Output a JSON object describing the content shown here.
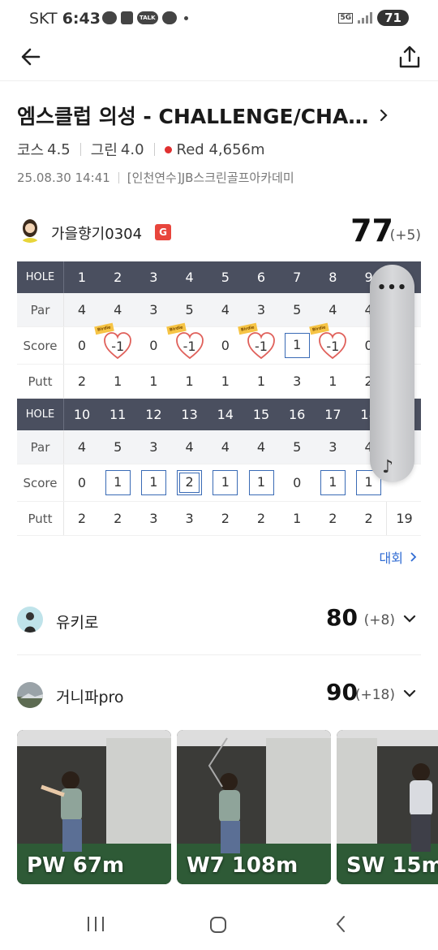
{
  "status": {
    "carrier": "SKT",
    "time": "6:43",
    "talk": "TALK",
    "network": "5G",
    "battery": "71"
  },
  "course": {
    "title": "엠스클럽 의성 - CHALLENGE/CHA…",
    "course_label": "코스",
    "course_value": "4.5",
    "green_label": "그린",
    "green_value": "4.0",
    "tee": "Red 4,656m",
    "datetime": "25.08.30 14:41",
    "venue": "[인천연수]JB스크린골프아카데미"
  },
  "player1": {
    "name": "가을향기0304",
    "badge": "G",
    "total": "77",
    "diff": "(+5)"
  },
  "scorecard": {
    "hole_label": "HOLE",
    "par_label": "Par",
    "score_label": "Score",
    "putt_label": "Putt",
    "front": {
      "holes": [
        "1",
        "2",
        "3",
        "4",
        "5",
        "6",
        "7",
        "8",
        "9"
      ],
      "par": [
        "4",
        "4",
        "3",
        "5",
        "4",
        "3",
        "5",
        "4",
        "4"
      ],
      "score": [
        "0",
        "-1",
        "0",
        "-1",
        "0",
        "-1",
        "1",
        "-1",
        "0"
      ],
      "putt": [
        "2",
        "1",
        "1",
        "1",
        "1",
        "1",
        "3",
        "1",
        "2"
      ]
    },
    "back": {
      "holes": [
        "10",
        "11",
        "12",
        "13",
        "14",
        "15",
        "16",
        "17",
        "18"
      ],
      "par": [
        "4",
        "5",
        "3",
        "4",
        "4",
        "4",
        "5",
        "3",
        "4"
      ],
      "score": [
        "0",
        "1",
        "1",
        "2",
        "1",
        "1",
        "0",
        "1",
        "1"
      ],
      "putt": [
        "2",
        "2",
        "3",
        "3",
        "2",
        "2",
        "1",
        "2",
        "2"
      ],
      "putt_total": "19"
    },
    "birdie_tag": "Birdie"
  },
  "overlay": {
    "menu": "•••",
    "note": "♪"
  },
  "more_link": "대회",
  "players": [
    {
      "name": "유키로",
      "total": "80",
      "diff": "(+8)"
    },
    {
      "name": "거니파pro",
      "total": "90",
      "diff": "(+18)"
    }
  ],
  "shots": [
    {
      "label": "PW 67m"
    },
    {
      "label": "W7 108m"
    },
    {
      "label": "SW 15m"
    }
  ]
}
